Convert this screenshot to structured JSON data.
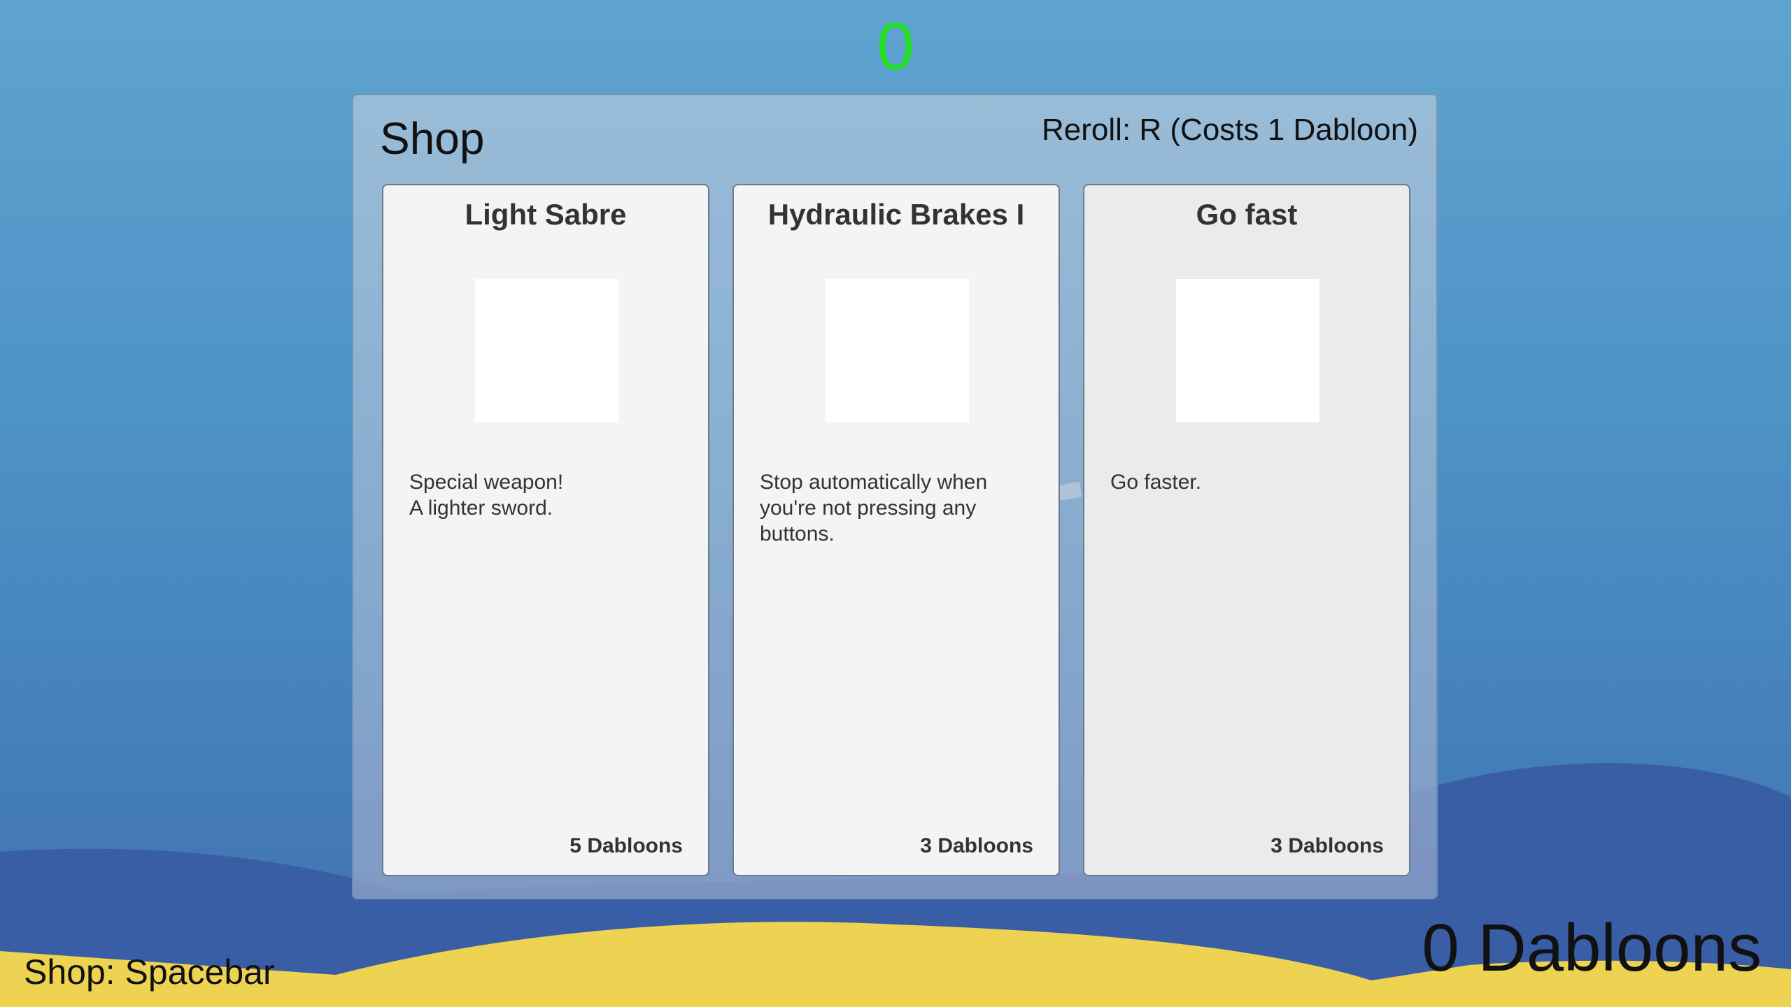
{
  "hud": {
    "score": "0",
    "shop_hint": "Shop: Spacebar",
    "currency": "0 Dabloons"
  },
  "shop": {
    "title": "Shop",
    "reroll": "Reroll: R (Costs 1 Dabloon)",
    "items": [
      {
        "name": "Light Sabre",
        "description": "Special weapon!\nA lighter sword.",
        "price": "5 Dabloons"
      },
      {
        "name": "Hydraulic Brakes I",
        "description": "Stop automatically when you're not pressing any buttons.",
        "price": "3 Dabloons"
      },
      {
        "name": "Go fast",
        "description": "Go faster.",
        "price": "3 Dabloons"
      }
    ]
  },
  "colors": {
    "score": "#22e022",
    "sky": "#4e93c6",
    "ground": "#edd351",
    "hills": "#3a5ea5"
  }
}
